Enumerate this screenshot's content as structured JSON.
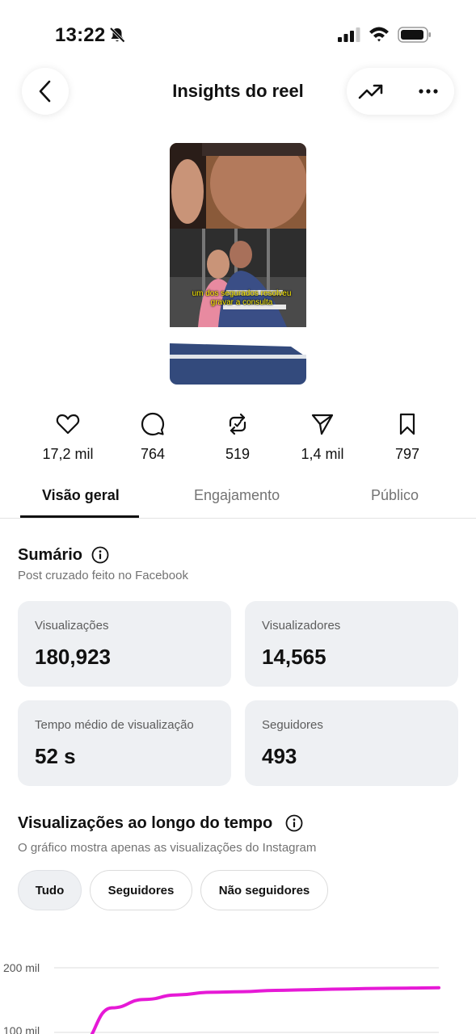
{
  "status_bar": {
    "time": "13:22"
  },
  "header": {
    "title": "Insights do reel"
  },
  "reel": {
    "caption": "um dos segurados resolveu gravar a consulta"
  },
  "stats": [
    {
      "icon": "heart-icon",
      "value": "17,2 mil"
    },
    {
      "icon": "comment-icon",
      "value": "764"
    },
    {
      "icon": "repost-icon",
      "value": "519"
    },
    {
      "icon": "share-icon",
      "value": "1,4 mil"
    },
    {
      "icon": "save-icon",
      "value": "797"
    }
  ],
  "tabs": [
    {
      "label": "Visão geral",
      "active": true
    },
    {
      "label": "Engajamento",
      "active": false
    },
    {
      "label": "Público",
      "active": false
    }
  ],
  "summary": {
    "title": "Sumário",
    "subtitle": "Post cruzado feito no Facebook",
    "cards": [
      {
        "label": "Visualizações",
        "value": "180,923"
      },
      {
        "label": "Visualizadores",
        "value": "14,565"
      },
      {
        "label": "Tempo médio de visualização",
        "value": "52 s"
      },
      {
        "label": "Seguidores",
        "value": "493"
      }
    ]
  },
  "views_over_time": {
    "title": "Visualizações ao longo do tempo",
    "subtitle": "O gráfico mostra apenas as visualizações do Instagram",
    "filters": [
      {
        "label": "Tudo",
        "active": true
      },
      {
        "label": "Seguidores",
        "active": false
      },
      {
        "label": "Não seguidores",
        "active": false
      }
    ]
  },
  "colors": {
    "accent_line": "#e619d6",
    "card_bg": "#eef0f3"
  },
  "chart_data": {
    "type": "line",
    "y_ticks": [
      "200 mil",
      "100 mil"
    ],
    "ylim": [
      0,
      200000
    ],
    "series": [
      {
        "values": [
          80000,
          138000,
          151000,
          158000,
          162000,
          163000,
          165000,
          166000,
          167000,
          168000,
          168500,
          169000
        ]
      }
    ]
  }
}
